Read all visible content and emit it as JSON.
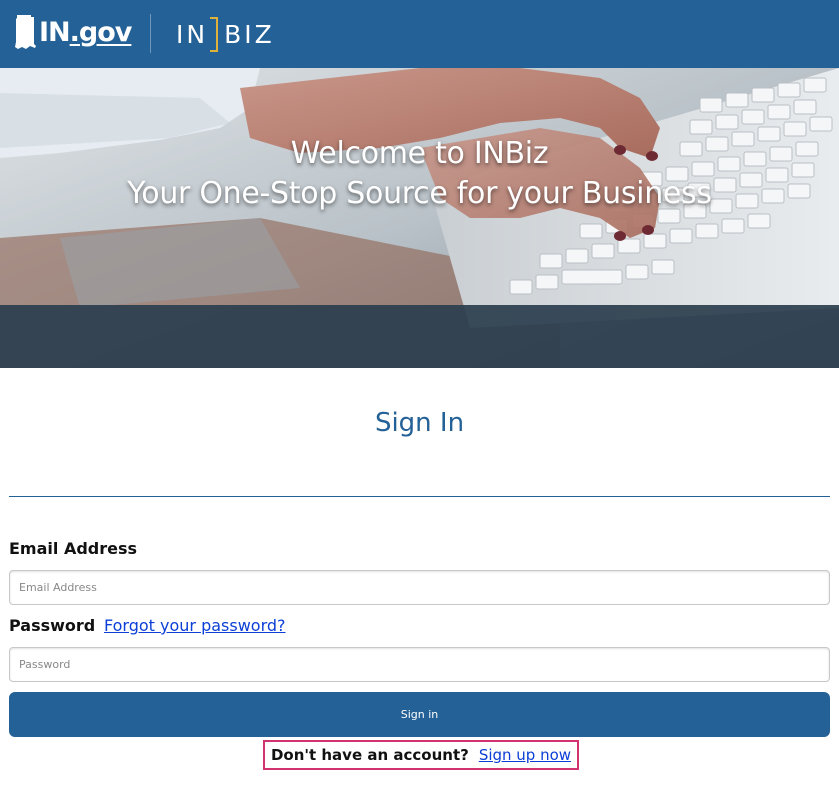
{
  "header": {
    "ingov_logo_text": "IN",
    "ingov_logo_suffix": ".gov",
    "inbiz_left": "IN",
    "inbiz_right": "BIZ",
    "brand_color": "#246196",
    "accent_color": "#e0b13a"
  },
  "hero": {
    "line1": "Welcome to INBiz",
    "line2": "Your One-Stop Source for your Business"
  },
  "signin": {
    "title": "Sign In",
    "email_label": "Email Address",
    "email_placeholder": "Email Address",
    "email_value": "",
    "password_label": "Password",
    "forgot_link": "Forgot your password?",
    "password_placeholder": "Password",
    "password_value": "",
    "submit_label": "Sign in",
    "no_account_text": "Don't have an account?",
    "signup_link": "Sign up now"
  },
  "colors": {
    "link": "#0b3fd6",
    "highlight_border": "#d1336f"
  }
}
